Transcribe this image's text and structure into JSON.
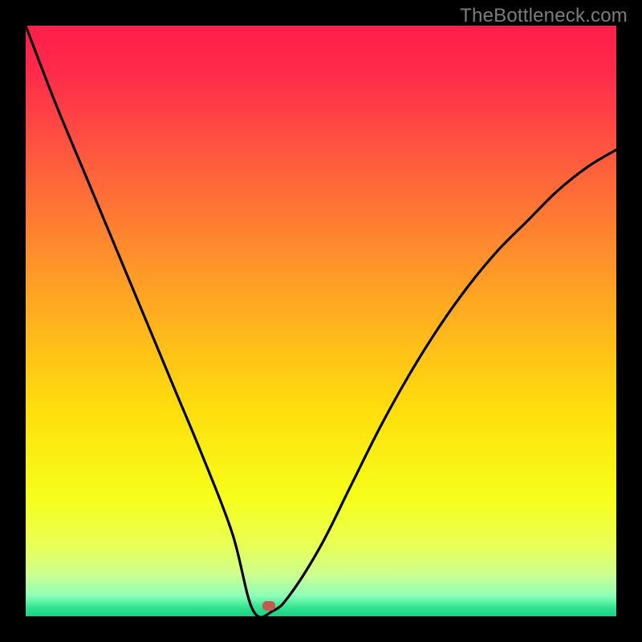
{
  "watermark": "TheBottleneck.com",
  "marker": {
    "x_frac": 0.412,
    "y_frac": 0.982,
    "color": "#c65a4e"
  },
  "chart_data": {
    "type": "line",
    "title": "",
    "xlabel": "",
    "ylabel": "",
    "xlim": [
      0,
      1
    ],
    "ylim": [
      0,
      100
    ],
    "grid": false,
    "legend": false,
    "note": "x is normalized horizontal position across the plot (0=left edge, 1=right edge); y is approximate bottleneck percentage (0 at bottom, 100 at top).",
    "series": [
      {
        "name": "bottleneck-curve",
        "x": [
          0.0,
          0.05,
          0.1,
          0.15,
          0.2,
          0.25,
          0.3,
          0.35,
          0.385,
          0.42,
          0.45,
          0.5,
          0.55,
          0.6,
          0.65,
          0.7,
          0.75,
          0.8,
          0.85,
          0.9,
          0.95,
          1.0
        ],
        "y": [
          100,
          87,
          75,
          63,
          51,
          39,
          27,
          14,
          1,
          1,
          4,
          12,
          22,
          32,
          41,
          49,
          56,
          62,
          67,
          72,
          76,
          79
        ]
      }
    ],
    "background_gradient": {
      "stops": [
        {
          "pos": 0.0,
          "color": "#ff1f4b"
        },
        {
          "pos": 0.08,
          "color": "#ff2b4a"
        },
        {
          "pos": 0.2,
          "color": "#ff5240"
        },
        {
          "pos": 0.35,
          "color": "#ff8330"
        },
        {
          "pos": 0.5,
          "color": "#ffb21e"
        },
        {
          "pos": 0.65,
          "color": "#ffde0c"
        },
        {
          "pos": 0.8,
          "color": "#f6ff1a"
        },
        {
          "pos": 0.88,
          "color": "#e8ff55"
        },
        {
          "pos": 0.93,
          "color": "#ccff8f"
        },
        {
          "pos": 0.965,
          "color": "#8effb8"
        },
        {
          "pos": 0.985,
          "color": "#30e591"
        },
        {
          "pos": 1.0,
          "color": "#18cf82"
        }
      ]
    }
  }
}
